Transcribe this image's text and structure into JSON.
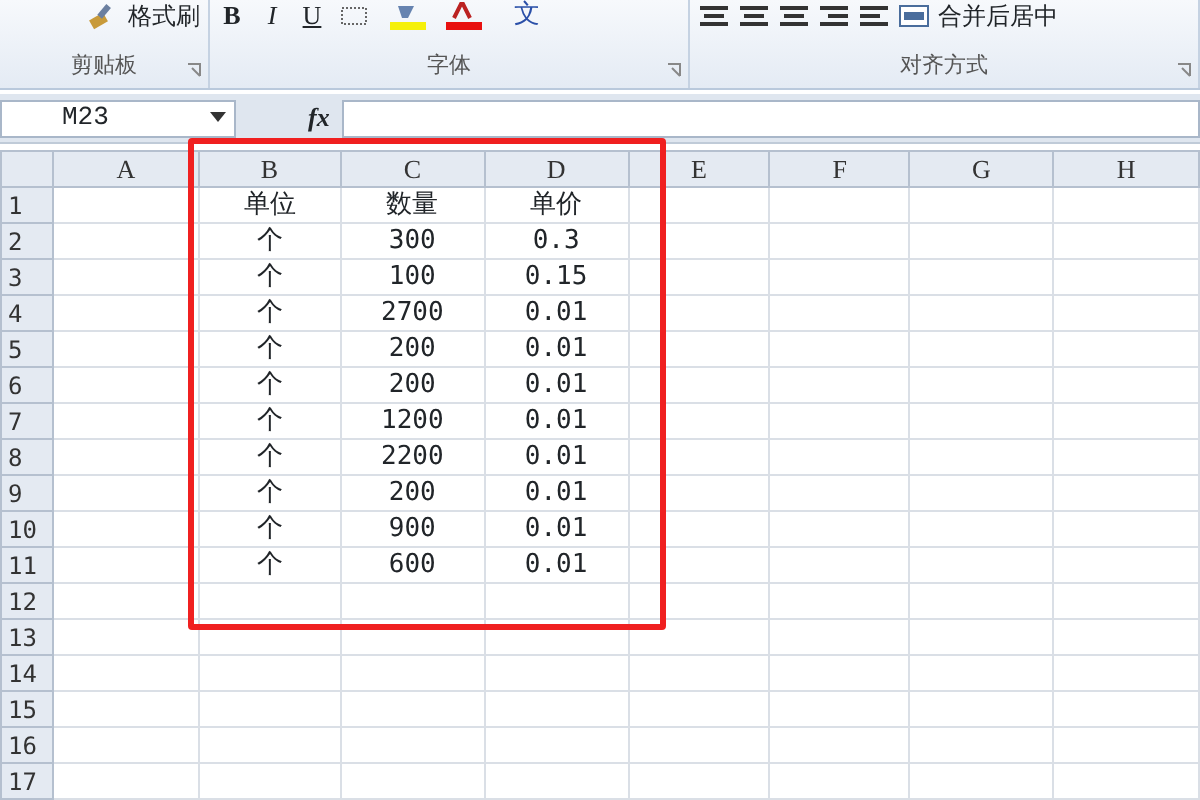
{
  "ribbon": {
    "groups": [
      {
        "label": "剪贴板",
        "button": "格式刷"
      },
      {
        "label": "字体",
        "format_buttons": [
          "B",
          "I",
          "U"
        ],
        "phonetic": "文"
      },
      {
        "label": "对齐方式",
        "button": "合并后居中"
      }
    ]
  },
  "formula_bar": {
    "name_box": "M23",
    "fx": "fx"
  },
  "columns": [
    "A",
    "B",
    "C",
    "D",
    "E",
    "F",
    "G",
    "H"
  ],
  "rows": [
    {
      "number": "1",
      "values": [
        "单位",
        "数量",
        "单价"
      ]
    },
    {
      "number": "2",
      "values": [
        "个",
        "300",
        "0.3"
      ]
    },
    {
      "number": "3",
      "values": [
        "个",
        "100",
        "0.15"
      ]
    },
    {
      "number": "4",
      "values": [
        "个",
        "2700",
        "0.01"
      ]
    },
    {
      "number": "5",
      "values": [
        "个",
        "200",
        "0.01"
      ]
    },
    {
      "number": "6",
      "values": [
        "个",
        "200",
        "0.01"
      ]
    },
    {
      "number": "7",
      "values": [
        "个",
        "1200",
        "0.01"
      ]
    },
    {
      "number": "8",
      "values": [
        "个",
        "2200",
        "0.01"
      ]
    },
    {
      "number": "9",
      "values": [
        "个",
        "200",
        "0.01"
      ]
    },
    {
      "number": "10",
      "values": [
        "个",
        "900",
        "0.01"
      ]
    },
    {
      "number": "11",
      "values": [
        "个",
        "600",
        "0.01"
      ]
    },
    {
      "number": "12"
    },
    {
      "number": "13"
    },
    {
      "number": "14"
    },
    {
      "number": "15"
    },
    {
      "number": "16"
    },
    {
      "number": "17"
    }
  ],
  "highlight_rectangle": true
}
